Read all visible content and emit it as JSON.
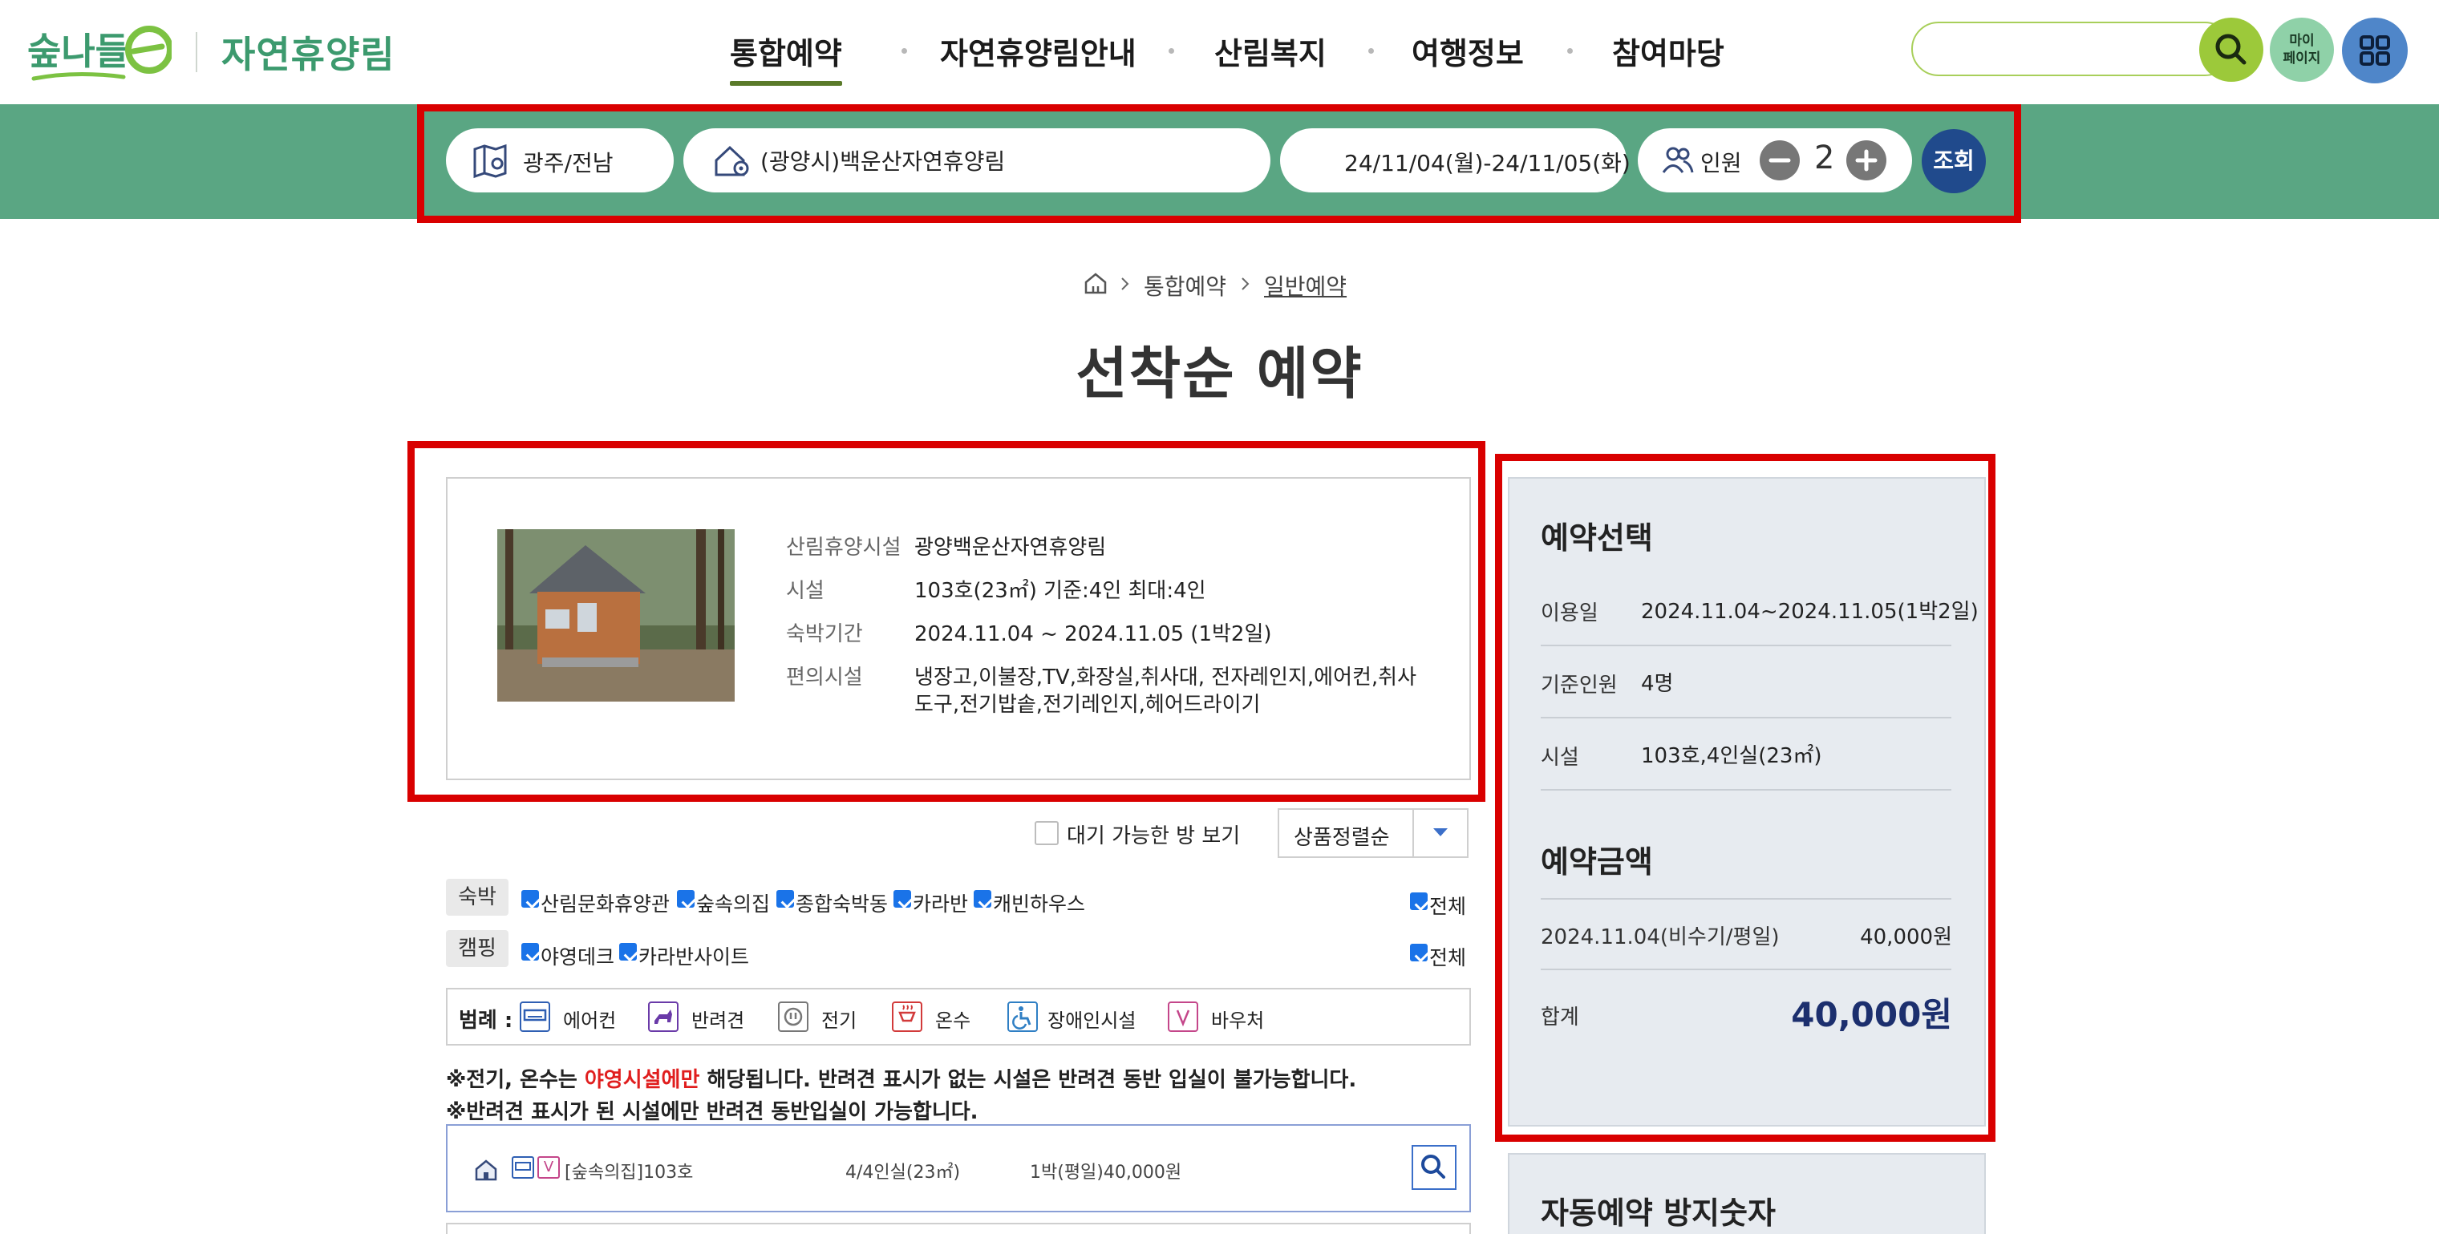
{
  "header": {
    "logo_text": "숲나들e",
    "site_name": "자연휴양림",
    "nav": [
      "통합예약",
      "자연휴양림안내",
      "산림복지",
      "여행정보",
      "참여마당"
    ],
    "active_nav": "통합예약",
    "mypage_label_line1": "마이",
    "mypage_label_line2": "페이지",
    "search_placeholder": ""
  },
  "searchbar": {
    "region": "광주/전남",
    "forest": "(광양시)백운산자연휴양림",
    "dates": "24/11/04(월)-24/11/05(화)",
    "people_label": "인원",
    "people_count": "2",
    "query_label": "조회"
  },
  "breadcrumb": [
    "통합예약",
    "일반예약"
  ],
  "page_title": "선착순 예약",
  "facility": {
    "rows": [
      {
        "label": "산림휴양시설",
        "value": "광양백운산자연휴양림"
      },
      {
        "label": "시설",
        "value": "103호(23㎡) 기준:4인 최대:4인"
      },
      {
        "label": "숙박기간",
        "value": "2024.11.04 ~ 2024.11.05 (1박2일)"
      },
      {
        "label": "편의시설",
        "value": "냉장고,이불장,TV,화장실,취사대, 전자레인지,에어컨,취사",
        "value2": "도구,전기밥솥,전기레인지,헤어드라이기"
      }
    ]
  },
  "filters": {
    "waitlist_label": "대기 가능한 방 보기",
    "sort_value": "상품정렬순",
    "lodging_tag": "숙박",
    "lodging_items": [
      "산림문화휴양관",
      "숲속의집",
      "종합숙박동",
      "카라반",
      "캐빈하우스"
    ],
    "camping_tag": "캠핑",
    "camping_items": [
      "야영데크",
      "카라반사이트"
    ],
    "all_label": "전체"
  },
  "legend": {
    "title": "범례 :",
    "items": [
      {
        "label": "에어컨",
        "icon": "aircon-icon",
        "color": "#2f5fb3"
      },
      {
        "label": "반려견",
        "icon": "pet-icon",
        "color": "#6a3aa8"
      },
      {
        "label": "전기",
        "icon": "electric-icon",
        "color": "#777777"
      },
      {
        "label": "온수",
        "icon": "hotwater-icon",
        "color": "#d23a3a"
      },
      {
        "label": "장애인시설",
        "icon": "accessible-icon",
        "color": "#2f7fc4"
      },
      {
        "label": "바우처",
        "icon": "voucher-icon",
        "color": "#c4468a"
      }
    ]
  },
  "notices": {
    "line1_pre": "※전기, 온수는 ",
    "line1_red": "야영시설에만",
    "line1_post": " 해당됩니다. 반려견 표시가 없는 시설은 반려견 동반 입실이 불가능합니다.",
    "line2": "※반려견 표시가 된 시설에만 반려견 동반입실이 가능합니다."
  },
  "room": {
    "name": "[숲속의집]103호",
    "capacity": "4/4인실(23㎡)",
    "price": "1박(평일)40,000원",
    "voucher_mark": "V"
  },
  "reservation": {
    "title": "예약선택",
    "rows": [
      {
        "label": "이용일",
        "value": "2024.11.04~2024.11.05(1박2일)"
      },
      {
        "label": "기준인원",
        "value": "4명"
      },
      {
        "label": "시설",
        "value": "103호,4인실(23㎡)"
      }
    ],
    "price_title": "예약금액",
    "price_rows": [
      {
        "label": "2024.11.04(비수기/평일)",
        "value": "40,000원"
      }
    ],
    "total_label": "합계",
    "total_value": "40,000원",
    "captcha_title": "자동예약 방지숫자"
  },
  "colors": {
    "brand_green": "#5aa683",
    "highlight_red": "#d90000",
    "navy": "#204a8c",
    "total_navy": "#1c2f6e"
  }
}
